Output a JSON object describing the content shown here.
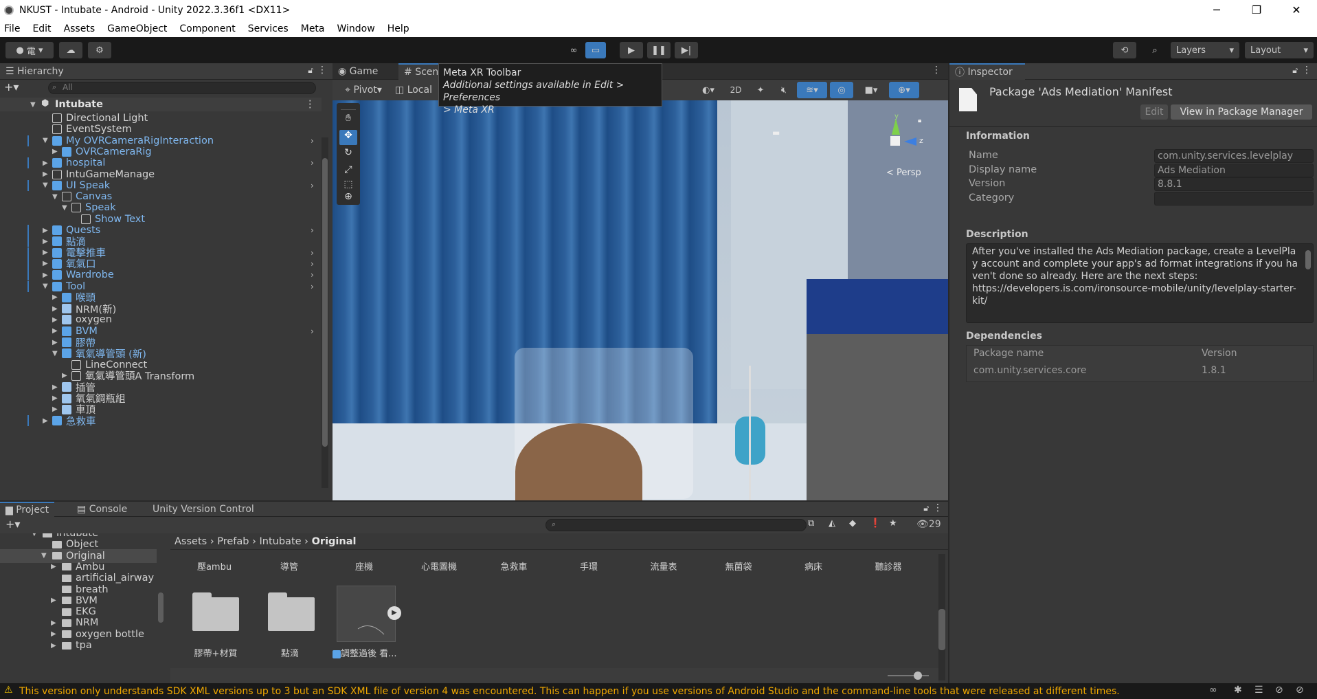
{
  "window": {
    "title": "NKUST - Intubate - Android - Unity 2022.3.36f1 <DX11>",
    "minimize": "─",
    "maximize": "❐",
    "close": "✕"
  },
  "menu": [
    "File",
    "Edit",
    "Assets",
    "GameObject",
    "Component",
    "Services",
    "Meta",
    "Window",
    "Help"
  ],
  "toolbar": {
    "account_label": "電",
    "layers": "Layers",
    "layout": "Layout"
  },
  "hierarchy": {
    "tab": "Hierarchy",
    "search_placeholder": "All",
    "scene": "Intubate",
    "items": [
      {
        "label": "Directional Light",
        "indent": 1,
        "prefab": false,
        "arrow": "",
        "sub": false
      },
      {
        "label": "EventSystem",
        "indent": 1,
        "prefab": false,
        "arrow": "",
        "sub": false
      },
      {
        "label": "My OVRCameraRigInteraction",
        "indent": 1,
        "prefab": true,
        "arrow": "▼",
        "sub": true
      },
      {
        "label": "OVRCameraRig",
        "indent": 2,
        "prefab": true,
        "arrow": "▶",
        "sub": false
      },
      {
        "label": "hospital",
        "indent": 1,
        "prefab": true,
        "arrow": "▶",
        "sub": true
      },
      {
        "label": "IntuGameManage",
        "indent": 1,
        "prefab": false,
        "arrow": "▶",
        "sub": false
      },
      {
        "label": "UI Speak",
        "indent": 1,
        "prefab": true,
        "arrow": "▼",
        "sub": true
      },
      {
        "label": "Canvas",
        "indent": 2,
        "prefab": false,
        "arrow": "▼",
        "sub": false,
        "blue": true
      },
      {
        "label": "Speak",
        "indent": 3,
        "prefab": false,
        "arrow": "▼",
        "sub": false,
        "blue": true
      },
      {
        "label": "Show Text",
        "indent": 4,
        "prefab": false,
        "arrow": "",
        "sub": false,
        "blue": true
      },
      {
        "label": "Quests",
        "indent": 1,
        "prefab": true,
        "arrow": "▶",
        "sub": true
      },
      {
        "label": "點滴",
        "indent": 1,
        "prefab": true,
        "arrow": "▶",
        "sub": false
      },
      {
        "label": "電擊推車",
        "indent": 1,
        "prefab": true,
        "arrow": "▶",
        "sub": true
      },
      {
        "label": "氧氣口",
        "indent": 1,
        "prefab": true,
        "arrow": "▶",
        "sub": true
      },
      {
        "label": "Wardrobe",
        "indent": 1,
        "prefab": true,
        "arrow": "▶",
        "sub": true
      },
      {
        "label": "Tool",
        "indent": 1,
        "prefab": true,
        "arrow": "▼",
        "sub": true
      },
      {
        "label": "喉頭",
        "indent": 2,
        "prefab": true,
        "arrow": "▶",
        "sub": false
      },
      {
        "label": "NRM(新)",
        "indent": 2,
        "prefab": false,
        "arrow": "▶",
        "sub": false,
        "plainprefab": true
      },
      {
        "label": "oxygen",
        "indent": 2,
        "prefab": false,
        "arrow": "▶",
        "sub": false,
        "plainprefab": true
      },
      {
        "label": "BVM",
        "indent": 2,
        "prefab": true,
        "arrow": "▶",
        "sub": true
      },
      {
        "label": "膠帶",
        "indent": 2,
        "prefab": true,
        "arrow": "▶",
        "sub": false
      },
      {
        "label": "氧氣導管頭 (新)",
        "indent": 2,
        "prefab": true,
        "arrow": "▼",
        "sub": false
      },
      {
        "label": "LineConnect",
        "indent": 3,
        "prefab": false,
        "arrow": "",
        "sub": false
      },
      {
        "label": "氧氣導管頭A Transform",
        "indent": 3,
        "prefab": false,
        "arrow": "▶",
        "sub": false
      },
      {
        "label": "插管",
        "indent": 2,
        "prefab": false,
        "arrow": "▶",
        "sub": false,
        "plainprefab": true
      },
      {
        "label": "氧氣鋼瓶組",
        "indent": 2,
        "prefab": false,
        "arrow": "▶",
        "sub": false,
        "plainprefab": true
      },
      {
        "label": "車頂",
        "indent": 2,
        "prefab": false,
        "arrow": "▶",
        "sub": false,
        "plainprefab": true
      },
      {
        "label": "急救車",
        "indent": 1,
        "prefab": true,
        "arrow": "▶",
        "sub": false
      }
    ]
  },
  "scene": {
    "tab_game": "Game",
    "tab_scene": "Scene",
    "pivot": "Pivot",
    "local": "Local",
    "btn_2d": "2D",
    "persp": "< Persp",
    "axis_y": "y",
    "axis_z": "z",
    "tooltip": {
      "title": "Meta XR Toolbar",
      "line1": "Additional settings available in Edit > Preferences",
      "line2": "> Meta XR"
    }
  },
  "inspector": {
    "tab": "Inspector",
    "title": "Package 'Ads Mediation' Manifest",
    "edit": "Edit",
    "view_pm": "View in Package Manager",
    "information": "Information",
    "fields": [
      {
        "label": "Name",
        "value": "com.unity.services.levelplay"
      },
      {
        "label": "Display name",
        "value": "Ads Mediation"
      },
      {
        "label": "Version",
        "value": "8.8.1"
      },
      {
        "label": "Category",
        "value": ""
      }
    ],
    "description_head": "Description",
    "description": "After you've installed the Ads Mediation package, create a LevelPlay account and complete your app's ad format integrations if you haven't done so already. Here are the next steps:\nhttps://developers.is.com/ironsource-mobile/unity/levelplay-starter-kit/",
    "dependencies_head": "Dependencies",
    "dep_col1": "Package name",
    "dep_col2": "Version",
    "deps": [
      {
        "name": "com.unity.services.core",
        "version": "1.8.1"
      }
    ]
  },
  "project": {
    "tab_project": "Project",
    "tab_console": "Console",
    "tab_uvc": "Unity Version Control",
    "count": "29",
    "breadcrumb": [
      "Assets",
      "Prefab",
      "Intubate",
      "Original"
    ],
    "tree": [
      {
        "label": "Intubate",
        "indent": 1,
        "arrow": "▼"
      },
      {
        "label": "Object",
        "indent": 2,
        "arrow": ""
      },
      {
        "label": "Original",
        "indent": 2,
        "arrow": "▼",
        "sel": true
      },
      {
        "label": "Ambu",
        "indent": 3,
        "arrow": "▶"
      },
      {
        "label": "artificial_airway",
        "indent": 3,
        "arrow": ""
      },
      {
        "label": "breath",
        "indent": 3,
        "arrow": ""
      },
      {
        "label": "BVM",
        "indent": 3,
        "arrow": "▶"
      },
      {
        "label": "EKG",
        "indent": 3,
        "arrow": ""
      },
      {
        "label": "NRM",
        "indent": 3,
        "arrow": "▶"
      },
      {
        "label": "oxygen bottle",
        "indent": 3,
        "arrow": "▶"
      },
      {
        "label": "tpa",
        "indent": 3,
        "arrow": "▶"
      }
    ],
    "columns": [
      "壓ambu",
      "導管",
      "座機",
      "心電圖機",
      "急救車",
      "手環",
      "流量表",
      "無菌袋",
      "病床",
      "聽診器"
    ],
    "assets": [
      {
        "label": "膠帶+材質",
        "type": "folder"
      },
      {
        "label": "點滴",
        "type": "folder"
      },
      {
        "label": "調整過後 看...",
        "type": "prefab"
      }
    ]
  },
  "status": {
    "message": "This version only understands SDK XML versions up to 3 but an SDK XML file of version 4 was encountered. This can happen if you use versions of Android Studio and the command-line tools that were released at different times."
  }
}
